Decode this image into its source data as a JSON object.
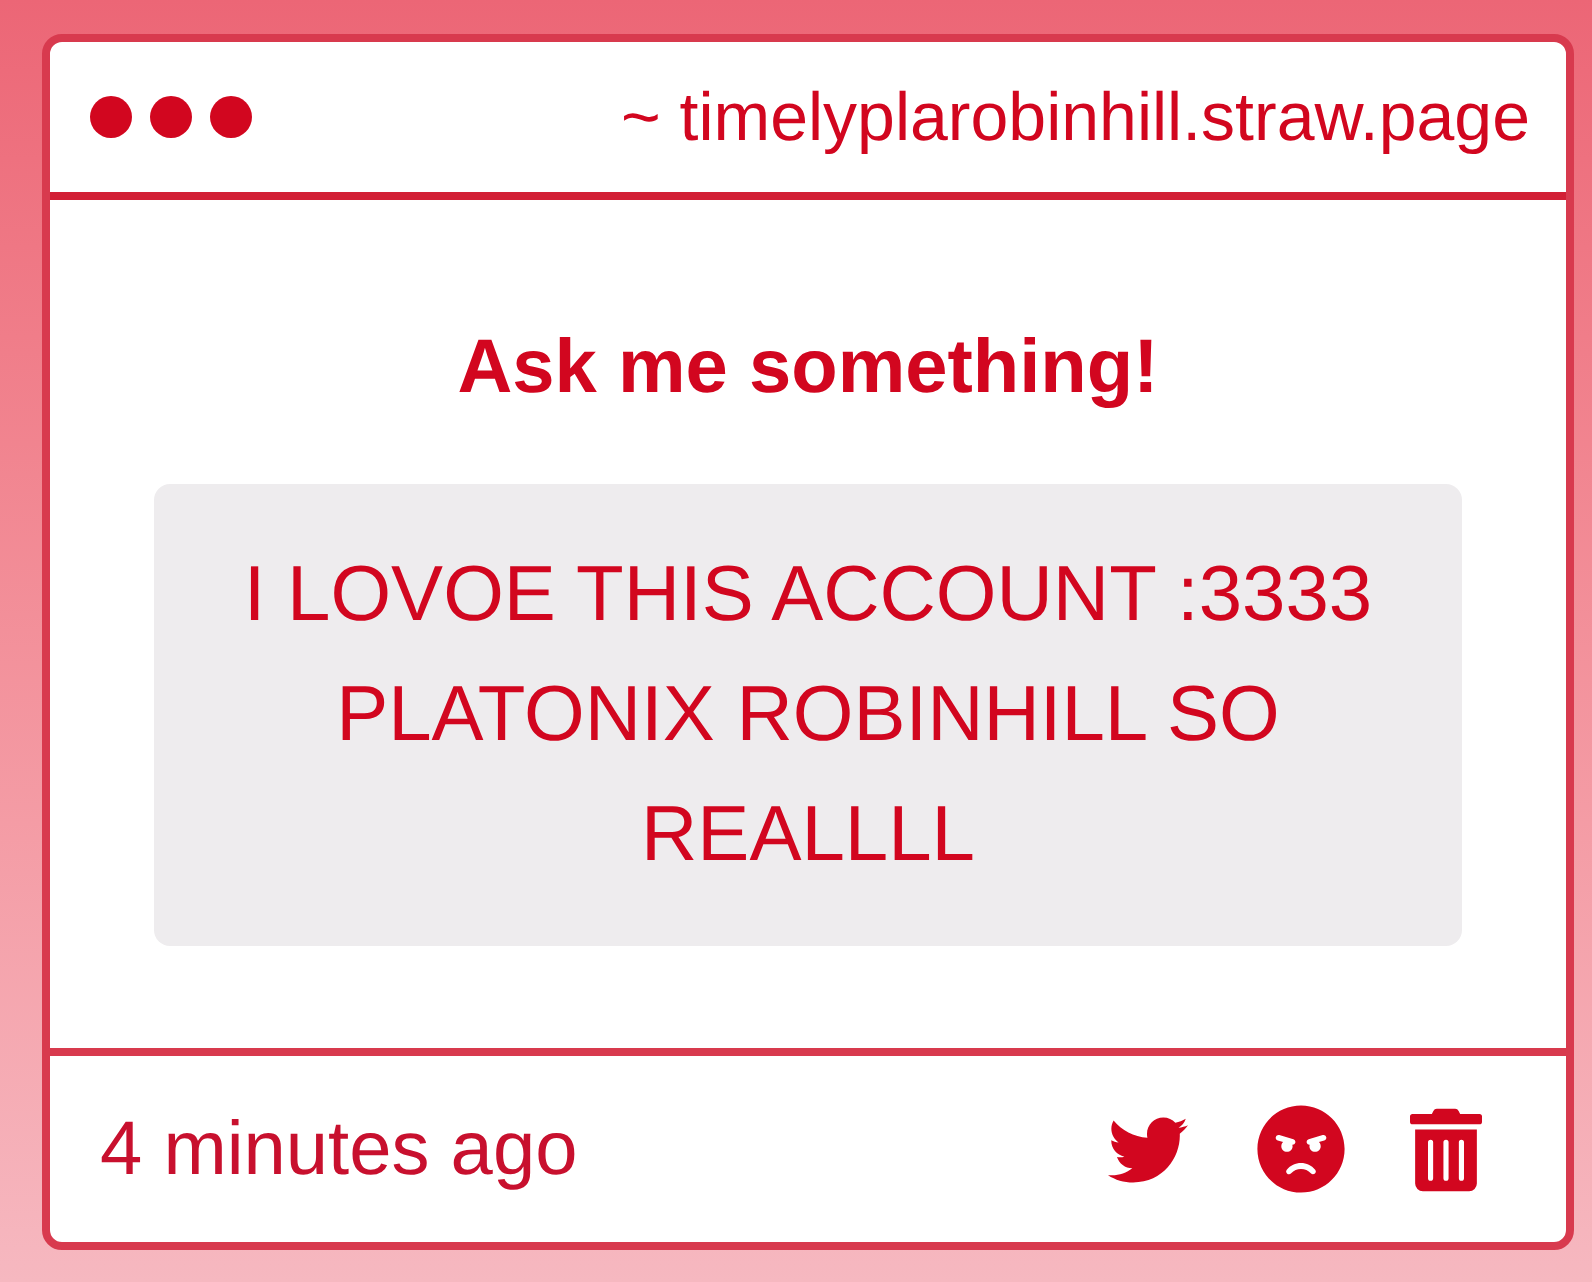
{
  "window": {
    "address": "~ timelyplarobinhill.straw.page"
  },
  "prompt": {
    "title": "Ask me something!",
    "message": "I LOVOE THIS ACCOUNT :3333 PLATONIX ROBINHILL SO REALLLL"
  },
  "footer": {
    "time": "4 minutes ago"
  }
}
